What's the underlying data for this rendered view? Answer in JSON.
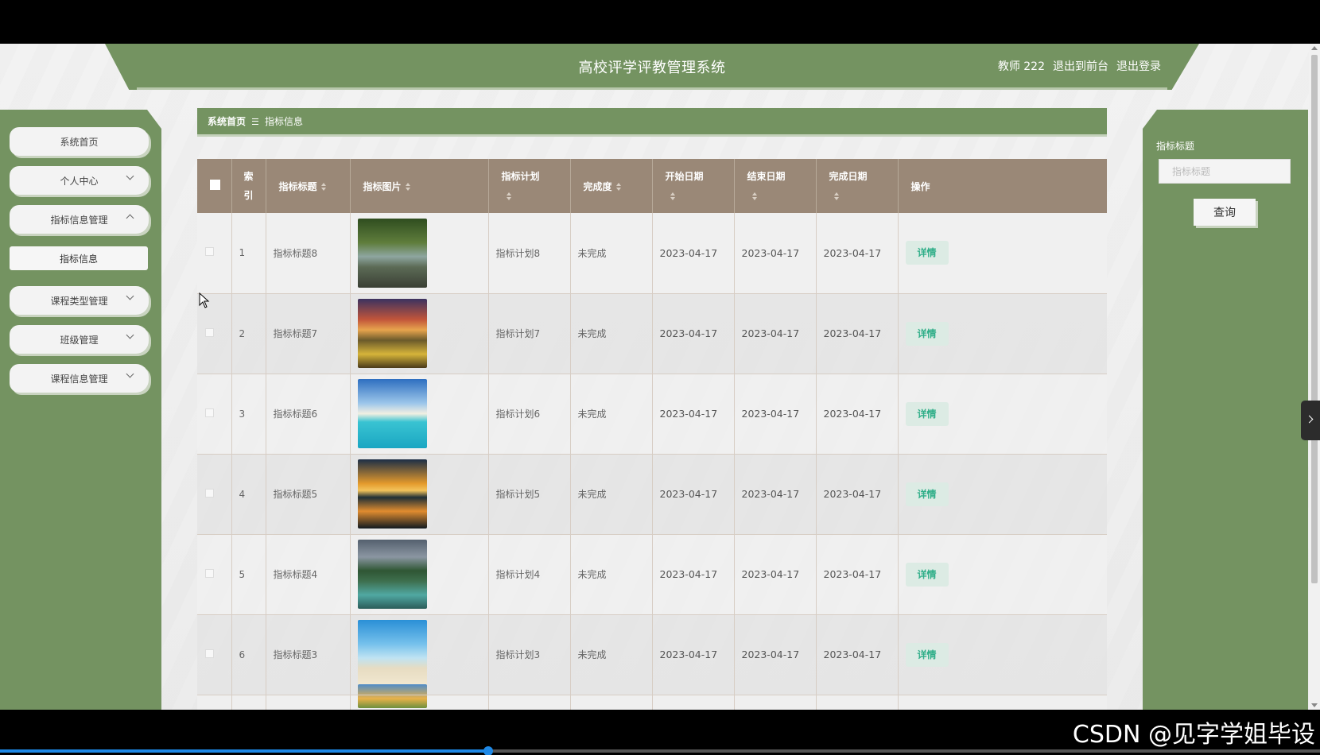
{
  "header": {
    "title": "高校评学评教管理系统",
    "user": "教师 222",
    "to_front": "退出到前台",
    "logout": "退出登录"
  },
  "sidebar": {
    "items": [
      {
        "label": "系统首页"
      },
      {
        "label": "个人中心"
      },
      {
        "label": "指标信息管理"
      },
      {
        "label": "指标信息"
      },
      {
        "label": "课程类型管理"
      },
      {
        "label": "班级管理"
      },
      {
        "label": "课程信息管理"
      }
    ]
  },
  "breadcrumb": {
    "home": "系统首页",
    "current": "指标信息"
  },
  "table": {
    "headers": {
      "index": "索引",
      "title": "指标标题",
      "image": "指标图片",
      "plan": "指标计划",
      "completion": "完成度",
      "start": "开始日期",
      "end": "结束日期",
      "done": "完成日期",
      "action": "操作"
    },
    "detail_label": "详情",
    "rows": [
      {
        "index": "1",
        "title": "指标标题8",
        "plan": "指标计划8",
        "completion": "未完成",
        "start": "2023-04-17",
        "end": "2023-04-17",
        "done": "2023-04-17",
        "image": "forest-stream"
      },
      {
        "index": "2",
        "title": "指标标题7",
        "plan": "指标计划7",
        "completion": "未完成",
        "start": "2023-04-17",
        "end": "2023-04-17",
        "done": "2023-04-17",
        "image": "sunset-meadow"
      },
      {
        "index": "3",
        "title": "指标标题6",
        "plan": "指标计划6",
        "completion": "未完成",
        "start": "2023-04-17",
        "end": "2023-04-17",
        "done": "2023-04-17",
        "image": "tropical-beach"
      },
      {
        "index": "4",
        "title": "指标标题5",
        "plan": "指标计划5",
        "completion": "未完成",
        "start": "2023-04-17",
        "end": "2023-04-17",
        "done": "2023-04-17",
        "image": "lake-sunset"
      },
      {
        "index": "5",
        "title": "指标标题4",
        "plan": "指标计划4",
        "completion": "未完成",
        "start": "2023-04-17",
        "end": "2023-04-17",
        "done": "2023-04-17",
        "image": "river-trees"
      },
      {
        "index": "6",
        "title": "指标标题3",
        "plan": "指标计划3",
        "completion": "未完成",
        "start": "2023-04-17",
        "end": "2023-04-17",
        "done": "2023-04-17",
        "image": "beach-umbrella"
      },
      {
        "index": "",
        "title": "",
        "plan": "",
        "completion": "",
        "start": "",
        "end": "",
        "done": "",
        "image": "mountain"
      }
    ]
  },
  "search": {
    "label": "指标标题",
    "placeholder": "指标标题",
    "button": "查询"
  },
  "watermark": "CSDN @见字学姐毕设",
  "video_progress": 0.37,
  "colors": {
    "primary_green": "#749361",
    "table_header": "#9a8877",
    "detail_text": "#2fae88"
  }
}
